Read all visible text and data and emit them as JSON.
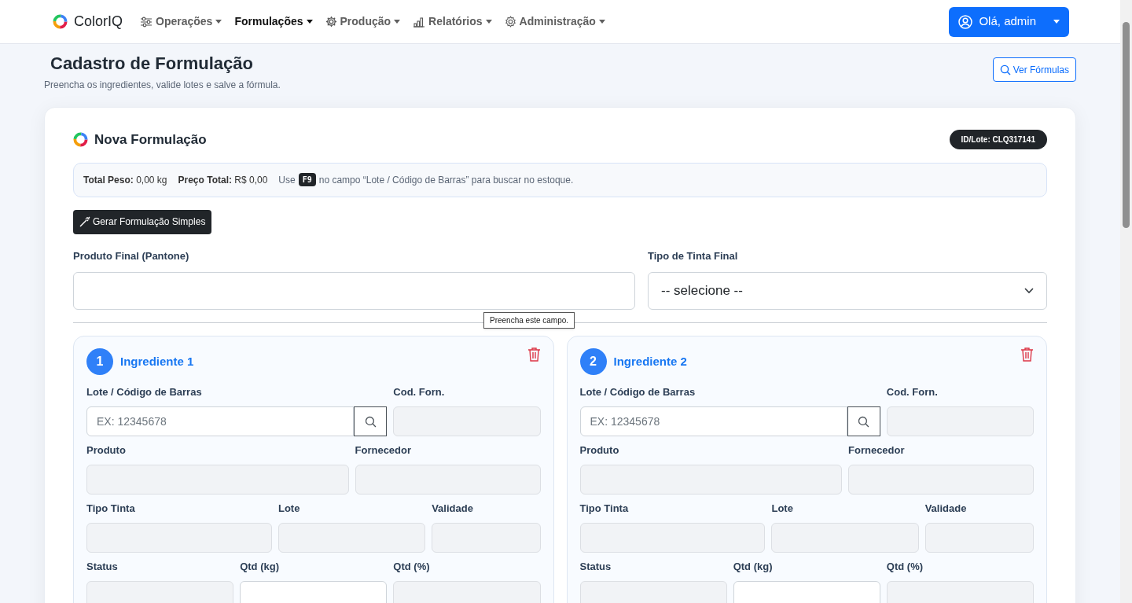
{
  "navbar": {
    "brand": "ColorIQ",
    "menus": [
      {
        "label": "Operações",
        "selected": false
      },
      {
        "label": "Formulações",
        "selected": true
      },
      {
        "label": "Produção",
        "selected": false
      },
      {
        "label": "Relatórios",
        "selected": false
      },
      {
        "label": "Administração",
        "selected": false
      }
    ],
    "user_button": "Olá, admin"
  },
  "header": {
    "title": "Cadastro de Formulação",
    "subtitle": "Preencha os ingredientes, valide lotes e salve a fórmula.",
    "view_button": "Ver Fórmulas"
  },
  "card": {
    "title": "Nova Formulação",
    "id_badge": "ID/Lote: CLQ317141",
    "summary": {
      "weight_label": "Total Peso:",
      "weight": "0,00 kg",
      "price_label": "Preço Total:",
      "price": "R$ 0,00",
      "hint_before": "Use",
      "key": "F9",
      "hint_after": "no campo “Lote / Código de Barras” para buscar no estoque."
    },
    "generate_button": "Gerar Formulação Simples",
    "final_product": {
      "label": "Produto Final (Pantone)"
    },
    "ink_type": {
      "label": "Tipo de Tinta Final",
      "value": "-- selecione --"
    },
    "tooltip": "Preencha este campo.",
    "ingredients": [
      {
        "number": "1",
        "title": "Ingrediente 1",
        "rows": [
          [
            {
              "label": "Lote / Código de Barras",
              "kind": "barcode",
              "placeholder": "EX: 12345678"
            },
            {
              "label": "Cod. Forn.",
              "kind": "readonly"
            }
          ],
          [
            {
              "label": "Produto",
              "kind": "readonly"
            },
            {
              "label": "Fornecedor",
              "kind": "readonly"
            }
          ],
          [
            {
              "label": "Tipo Tinta",
              "kind": "readonly"
            },
            {
              "label": "Lote",
              "kind": "readonly"
            },
            {
              "label": "Validade",
              "kind": "readonly"
            }
          ],
          [
            {
              "label": "Status",
              "kind": "readonly"
            },
            {
              "label": "Qtd (kg)",
              "kind": "input"
            },
            {
              "label": "Qtd (%)",
              "kind": "readonly"
            }
          ]
        ]
      },
      {
        "number": "2",
        "title": "Ingrediente 2",
        "rows": [
          [
            {
              "label": "Lote / Código de Barras",
              "kind": "barcode",
              "placeholder": "EX: 12345678"
            },
            {
              "label": "Cod. Forn.",
              "kind": "readonly"
            }
          ],
          [
            {
              "label": "Produto",
              "kind": "readonly"
            },
            {
              "label": "Fornecedor",
              "kind": "readonly"
            }
          ],
          [
            {
              "label": "Tipo Tinta",
              "kind": "readonly"
            },
            {
              "label": "Lote",
              "kind": "readonly"
            },
            {
              "label": "Validade",
              "kind": "readonly"
            }
          ],
          [
            {
              "label": "Status",
              "kind": "readonly"
            },
            {
              "label": "Qtd (kg)",
              "kind": "input"
            },
            {
              "label": "Qtd (%)",
              "kind": "readonly"
            }
          ]
        ]
      }
    ]
  }
}
